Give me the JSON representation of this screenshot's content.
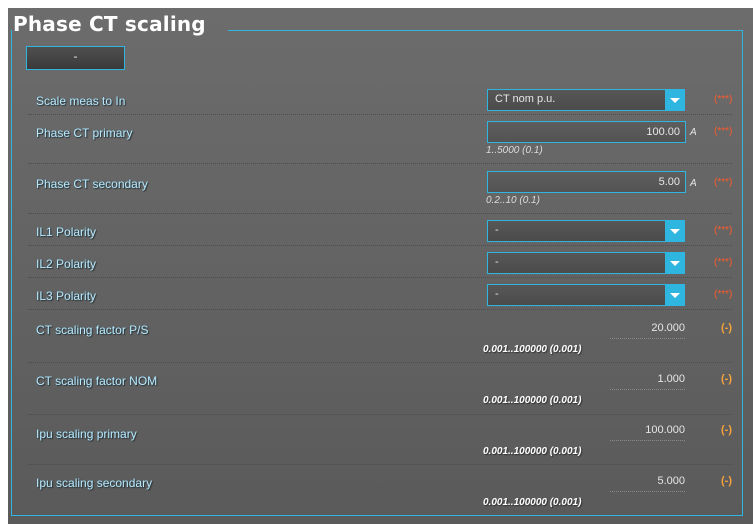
{
  "section": {
    "title": "Phase CT scaling",
    "collapse_label": "-"
  },
  "rows": {
    "scale_meas": {
      "label": "Scale meas to In",
      "value": "CT nom p.u.",
      "flag": "(***)"
    },
    "ct_primary": {
      "label": "Phase CT primary",
      "value": "100.00",
      "unit": "A",
      "range": "1..5000 (0.1)",
      "flag": "(***)"
    },
    "ct_secondary": {
      "label": "Phase CT secondary",
      "value": "5.00",
      "unit": "A",
      "range": "0.2..10 (0.1)",
      "flag": "(***)"
    },
    "il1_polarity": {
      "label": "IL1 Polarity",
      "value": "-",
      "flag": "(***)"
    },
    "il2_polarity": {
      "label": "IL2 Polarity",
      "value": "-",
      "flag": "(***)"
    },
    "il3_polarity": {
      "label": "IL3 Polarity",
      "value": "-",
      "flag": "(***)"
    },
    "ct_factor_ps": {
      "label": "CT scaling factor P/S",
      "value": "20.000",
      "range": "0.001..100000 (0.001)",
      "flag": "(-)"
    },
    "ct_factor_nom": {
      "label": "CT scaling factor NOM",
      "value": "1.000",
      "range": "0.001..100000 (0.001)",
      "flag": "(-)"
    },
    "ipu_primary": {
      "label": "Ipu scaling primary",
      "value": "100.000",
      "range": "0.001..100000 (0.001)",
      "flag": "(-)"
    },
    "ipu_secondary": {
      "label": "Ipu scaling secondary",
      "value": "5.000",
      "range": "0.001..100000 (0.001)",
      "flag": "(-)"
    }
  },
  "colors": {
    "accent": "#2fb6e0",
    "label": "#bfe7f7",
    "flag_required": "#ff5a2a",
    "flag_readonly": "#f3a23c",
    "panel": "#646464"
  }
}
